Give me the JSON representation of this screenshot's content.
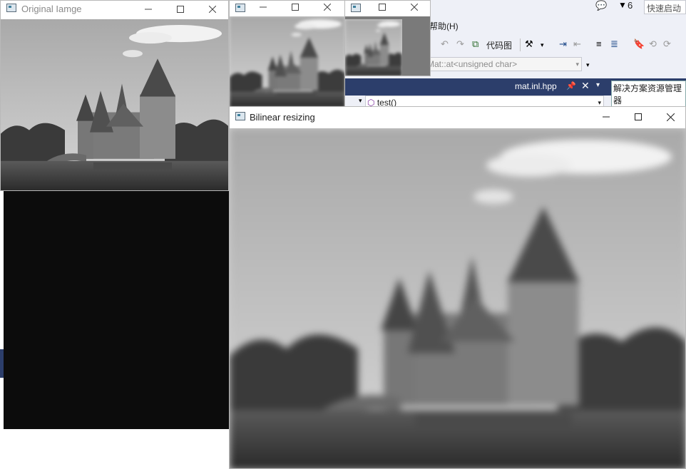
{
  "windows": {
    "original": {
      "title": "Original Iamge"
    },
    "small1": {
      "title": ""
    },
    "small2": {
      "title": ""
    },
    "bilinear": {
      "title": "Bilinear resizing"
    }
  },
  "window_controls": {
    "minimize": "—",
    "maximize": "☐",
    "close": "✕"
  },
  "ide": {
    "notification_count": "6",
    "quick_launch_placeholder": "快速启动",
    "menu_help": "帮助(H)",
    "toolbar_code_map": "代码图",
    "member_combo": "Mat::at<unsigned char>",
    "active_tab": "mat.inl.hpp",
    "function_combo": "test()",
    "solution_explorer": "解决方案资源管理器"
  },
  "colors": {
    "ide_background": "#eef0f7",
    "ide_tab_bar": "#2c3e6b",
    "console_background": "#0c0c0c"
  }
}
